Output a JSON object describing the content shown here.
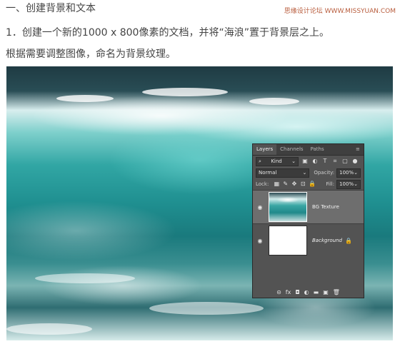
{
  "heading": "一、创建背景和文本",
  "watermark": "思缘设计论坛 WWW.MISSYUAN.COM",
  "paragraph": {
    "line1": "1．创建一个新的1000 x 800像素的文档，并将“海浪”置于背景层之上。",
    "line2": "根据需要调整图像，命名为背景纹理。"
  },
  "layers_panel": {
    "tabs": [
      "Layers",
      "Channels",
      "Paths"
    ],
    "active_tab": "Layers",
    "filter_kind": "Kind",
    "blend_mode": "Normal",
    "opacity_label": "Opacity:",
    "opacity_value": "100%",
    "lock_label": "Lock:",
    "fill_label": "Fill:",
    "fill_value": "100%",
    "layers": [
      {
        "name": "BG Texture",
        "selected": true,
        "visible": true
      },
      {
        "name": "Background",
        "selected": false,
        "visible": true,
        "locked": true
      }
    ],
    "footer_icons": [
      "link-icon",
      "fx-icon",
      "mask-icon",
      "adjustment-icon",
      "folder-icon",
      "new-layer-icon",
      "trash-icon"
    ],
    "footer_glyphs": [
      "⊝",
      "fx",
      "◘",
      "◐",
      "▬",
      "▣",
      "🗑"
    ]
  },
  "icons": {
    "filter": "⌕",
    "image": "▣",
    "adjust": "◐",
    "type": "T",
    "shape": "⌗",
    "smart": "▢",
    "eye": "◉",
    "lock": "🔒",
    "chevron": "⌄",
    "menu": "≡",
    "dot": "●",
    "lock_transparent": "▦",
    "lock_paint": "✎",
    "lock_move": "✥",
    "lock_artboard": "⊡",
    "lock_all": "🔒"
  }
}
